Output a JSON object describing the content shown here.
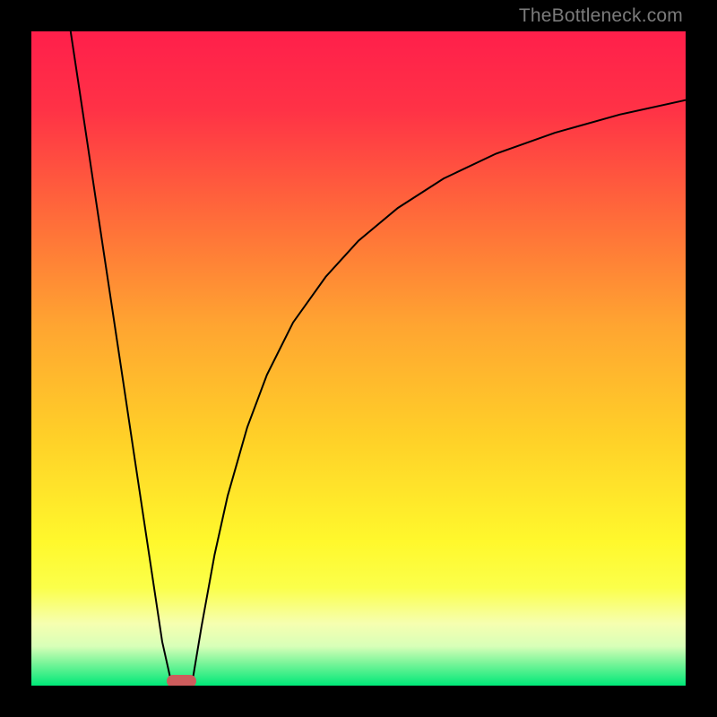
{
  "watermark": {
    "text": "TheBottleneck.com"
  },
  "chart_data": {
    "type": "line",
    "title": "",
    "xlabel": "",
    "ylabel": "",
    "x_range": [
      0,
      100
    ],
    "y_range": [
      0,
      100
    ],
    "gradient_stops": [
      {
        "offset": 0.0,
        "color": "#ff1f4b"
      },
      {
        "offset": 0.12,
        "color": "#ff3246"
      },
      {
        "offset": 0.28,
        "color": "#ff6a3a"
      },
      {
        "offset": 0.45,
        "color": "#ffa531"
      },
      {
        "offset": 0.62,
        "color": "#ffd028"
      },
      {
        "offset": 0.78,
        "color": "#fff82c"
      },
      {
        "offset": 0.85,
        "color": "#fbff4a"
      },
      {
        "offset": 0.905,
        "color": "#f6ffb0"
      },
      {
        "offset": 0.94,
        "color": "#d8ffb8"
      },
      {
        "offset": 0.965,
        "color": "#7cf59a"
      },
      {
        "offset": 1.0,
        "color": "#00e878"
      }
    ],
    "series": [
      {
        "name": "left-branch",
        "x": [
          6.0,
          8.0,
          10.0,
          12.0,
          14.0,
          16.0,
          18.0,
          20.0,
          21.5
        ],
        "y": [
          100.0,
          86.7,
          73.3,
          60.0,
          46.7,
          33.3,
          20.0,
          6.7,
          0.0
        ]
      },
      {
        "name": "right-branch",
        "x": [
          24.5,
          26.0,
          28.0,
          30.0,
          33.0,
          36.0,
          40.0,
          45.0,
          50.0,
          56.0,
          63.0,
          71.0,
          80.0,
          90.0,
          100.0
        ],
        "y": [
          0.0,
          9.0,
          20.0,
          29.0,
          39.5,
          47.5,
          55.5,
          62.5,
          68.0,
          73.0,
          77.5,
          81.3,
          84.5,
          87.3,
          89.5
        ]
      }
    ],
    "minimum_marker": {
      "x_start": 21.0,
      "x_end": 25.0,
      "y": 0.0,
      "color": "#cd5c5c"
    }
  }
}
